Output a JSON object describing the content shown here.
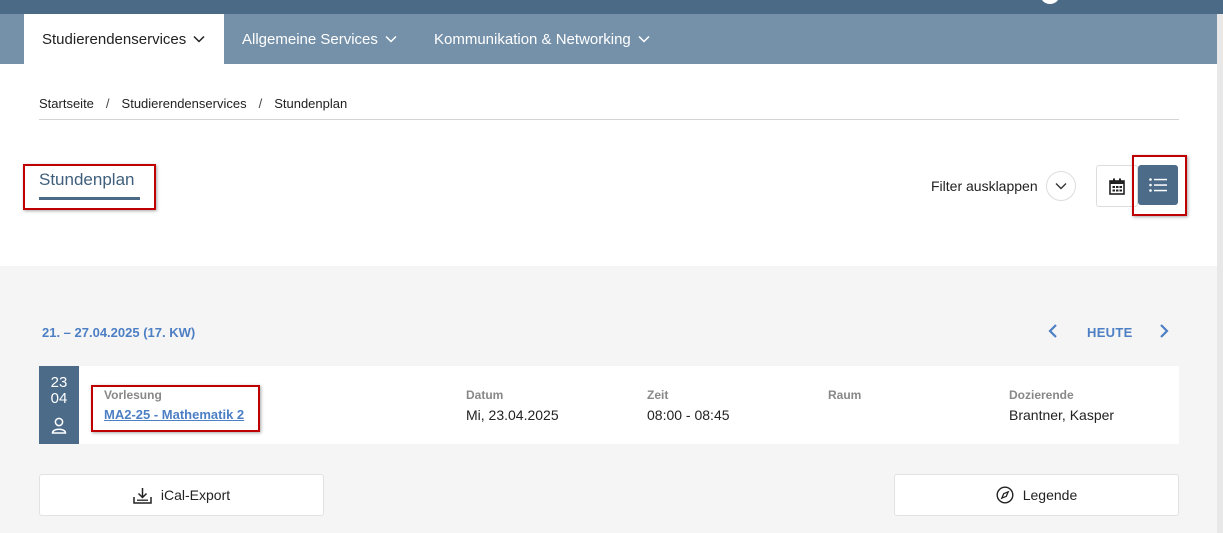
{
  "nav": {
    "tabs": [
      {
        "label": "Studierendenservices"
      },
      {
        "label": "Allgemeine Services"
      },
      {
        "label": "Kommunikation & Networking"
      }
    ]
  },
  "breadcrumb": [
    "Startseite",
    "Studierendenservices",
    "Stundenplan"
  ],
  "breadcrumb_separator": "/",
  "page": {
    "title": "Stundenplan",
    "filter_label": "Filter ausklappen"
  },
  "view_toggle": {
    "calendar_icon": "calendar-icon",
    "list_icon": "list-icon",
    "active": "list"
  },
  "week": {
    "range": "21. – 27.04.2025 (17. KW)",
    "today_label": "HEUTE"
  },
  "events": [
    {
      "day": "23",
      "month": "04",
      "type": "Vorlesung",
      "course": "MA2-25 - Mathematik 2",
      "datum_label": "Datum",
      "datum": "Mi, 23.04.2025",
      "zeit_label": "Zeit",
      "zeit": "08:00 - 08:45",
      "raum_label": "Raum",
      "raum": "",
      "dozierende_label": "Dozierende",
      "dozierende": "Brantner, Kasper"
    }
  ],
  "actions": {
    "ical_label": "iCal-Export",
    "legend_label": "Legende"
  },
  "colors": {
    "nav_bg": "#7591aa",
    "primary": "#4b6b89",
    "link": "#4d7fc4",
    "highlight": "#c00000"
  }
}
